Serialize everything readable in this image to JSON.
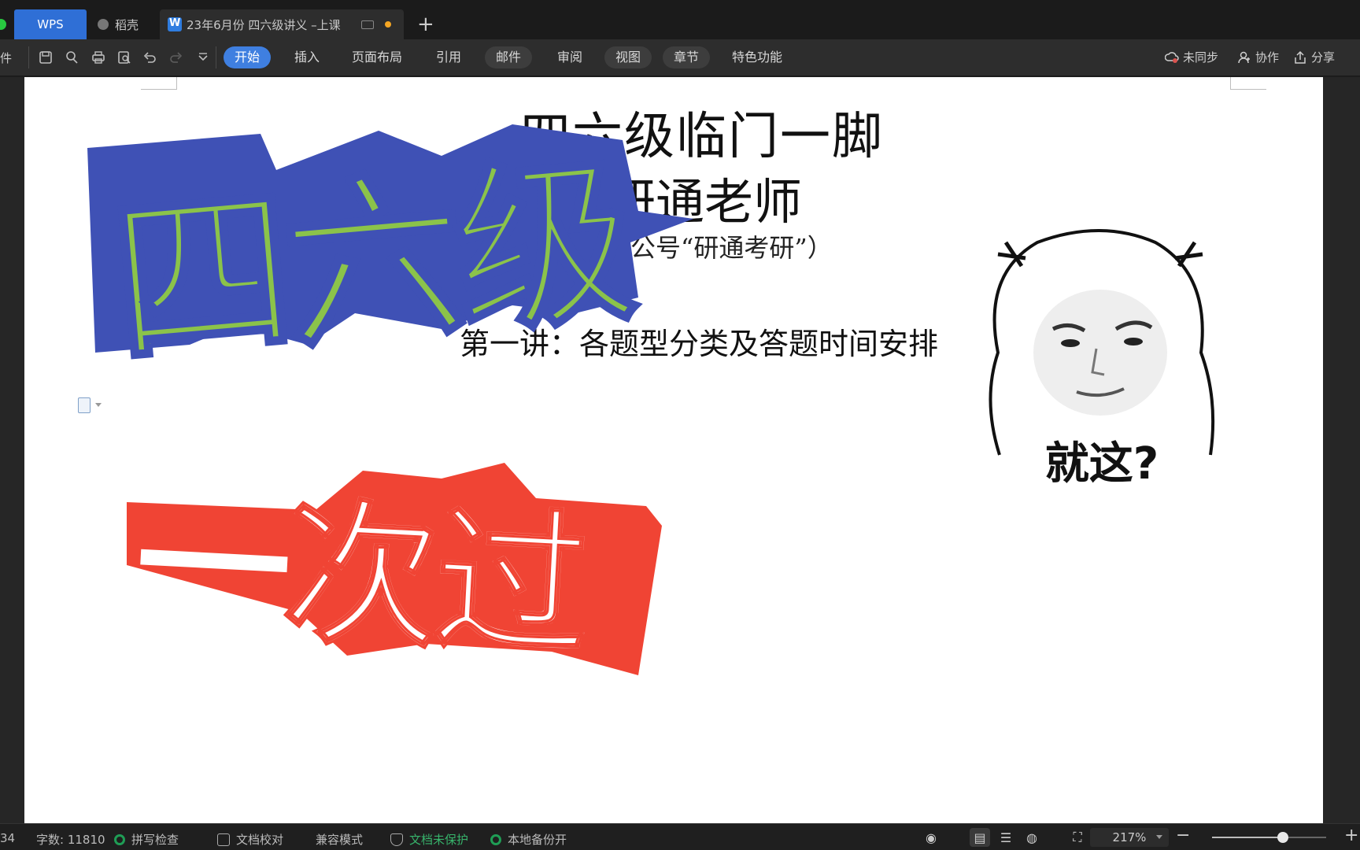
{
  "tabs": {
    "wps": "WPS",
    "daoke": "稻壳",
    "document": "23年6月份 四六级讲义 –上课",
    "add": "+"
  },
  "toolbar": {
    "file_partial": "件",
    "menu": [
      "开始",
      "插入",
      "页面布局",
      "引用",
      "邮件",
      "审阅",
      "视图",
      "章节",
      "特色功能"
    ],
    "active_menu": "开始",
    "sync": "未同步",
    "collab": "协作",
    "share": "分享"
  },
  "document": {
    "title": "四六级临门一脚",
    "subtitle": "研通老师",
    "note": "公号“研通考研”）",
    "lecture": "第一讲：各题型分类及答题时间安排"
  },
  "stickers": {
    "sixlevel": "四六级",
    "pass": "一次过",
    "meme_caption": "就这?"
  },
  "statusbar": {
    "page_partial": "34",
    "word_count": "字数: 11810",
    "spell_check": "拼写检查",
    "proofread": "文档校对",
    "compat_mode": "兼容模式",
    "protect": "文档未保护",
    "backup": "本地备份开",
    "zoom": "217%",
    "zoom_level": 0.62
  },
  "colors": {
    "accent": "#3f7fe0",
    "sticker_green": "#8bc34a",
    "sticker_blue": "#3f51b5",
    "sticker_red": "#f04434",
    "status_green": "#1f9d55"
  }
}
